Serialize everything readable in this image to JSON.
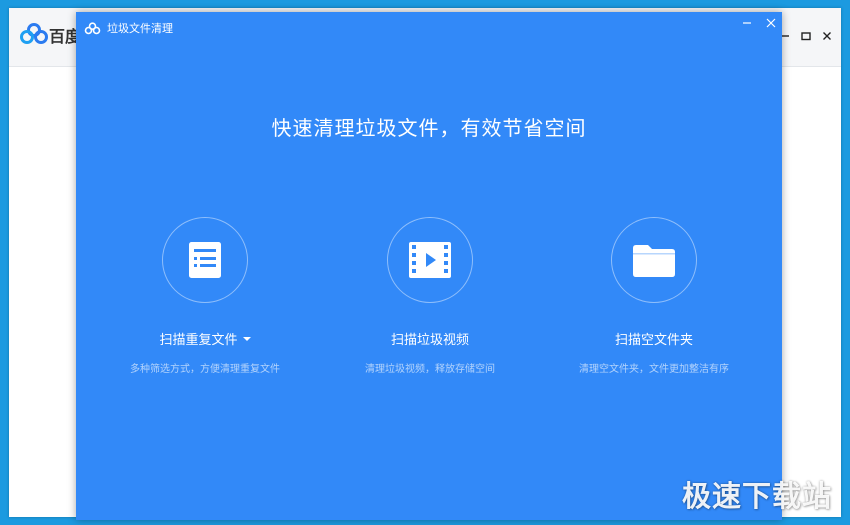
{
  "background_app": {
    "title": "百度",
    "logo_icon": "baidu-netdisk-cloud-icon"
  },
  "dialog": {
    "title": "垃圾文件清理",
    "logo_icon": "baidu-netdisk-cloud-icon",
    "headline": "快速清理垃圾文件，有效节省空间",
    "features": [
      {
        "icon": "duplicate-list-icon",
        "label": "扫描重复文件",
        "desc": "多种筛选方式，方便清理重复文件",
        "has_dropdown": true
      },
      {
        "icon": "video-film-icon",
        "label": "扫描垃圾视频",
        "desc": "清理垃圾视频，释放存储空间"
      },
      {
        "icon": "folder-icon",
        "label": "扫描空文件夹",
        "desc": "清理空文件夹，文件更加整洁有序"
      }
    ]
  },
  "watermark": "极速下载站",
  "colors": {
    "dialog_bg": "#3289f8",
    "desktop_bg": "#1c9ae0"
  }
}
